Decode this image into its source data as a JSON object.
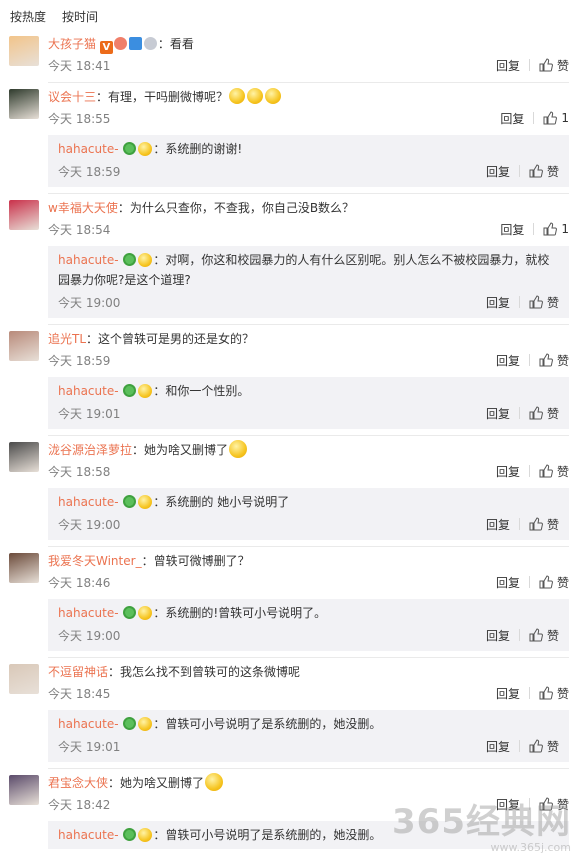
{
  "sort": {
    "hot": "按热度",
    "time": "按时间"
  },
  "actions": {
    "reply": "回复",
    "like": "赞"
  },
  "comments": [
    {
      "user": "大孩子猫",
      "text": "：看看",
      "time": "今天 18:41",
      "likes": "",
      "avatar_color": "#f2c48a",
      "badges": true,
      "replies": []
    },
    {
      "user": "议会十三",
      "text": "：有理，干吗删微博呢？",
      "time": "今天 18:55",
      "likes": "1",
      "avatar_color": "#2e3a2c",
      "emojis": 3,
      "replies": [
        {
          "user": "hahacute-",
          "text": "：系统删的谢谢!",
          "time": "今天 18:59"
        }
      ]
    },
    {
      "user": "w幸福大天使",
      "text": "：为什么只查你，不查我，你自己没B数么？",
      "time": "今天 18:54",
      "likes": "1",
      "avatar_color": "#c9304a",
      "replies": [
        {
          "user": "hahacute-",
          "text": "：对啊，你这和校园暴力的人有什么区别呢。别人怎么不被校园暴力，就校",
          "text2": "园暴力你呢?是这个道理?",
          "time": "今天 19:00"
        }
      ]
    },
    {
      "user": "追光TL",
      "text": "：这个曾轶可是男的还是女的？",
      "time": "今天 18:59",
      "likes": "",
      "avatar_color": "#b88a7a",
      "replies": [
        {
          "user": "hahacute-",
          "text": "：和你一个性别。",
          "time": "今天 19:01"
        }
      ]
    },
    {
      "user": "泷谷源治泽萝拉",
      "text": "：她为啥又删博了",
      "time": "今天 18:58",
      "likes": "",
      "avatar_color": "#4a4a4a",
      "emojis": 1,
      "replies": [
        {
          "user": "hahacute-",
          "text": "：系统删的 她小号说明了",
          "time": "今天 19:00"
        }
      ]
    },
    {
      "user": "我爱冬天Winter_",
      "text": "：曾轶可微博删了？",
      "time": "今天 18:46",
      "likes": "",
      "avatar_color": "#6b4a3a",
      "replies": [
        {
          "user": "hahacute-",
          "text": "：系统删的!曾轶可小号说明了。",
          "time": "今天 19:00"
        }
      ]
    },
    {
      "user": "不逗留神话",
      "text": "：我怎么找不到曾轶可的这条微博呢",
      "time": "今天 18:45",
      "likes": "",
      "avatar_color": "#d9c8b8",
      "replies": [
        {
          "user": "hahacute-",
          "text": "：曾轶可小号说明了是系统删的，她没删。",
          "time": "今天 19:01"
        }
      ]
    },
    {
      "user": "君宝念大侠",
      "text": "：她为啥又删博了",
      "time": "今天 18:42",
      "likes": "",
      "avatar_color": "#5a4a6a",
      "emojis": 1,
      "replies": [
        {
          "user": "hahacute-",
          "text": "：曾轶可小号说明了是系统删的，她没删。",
          "time": ""
        }
      ]
    }
  ],
  "watermark": {
    "big": "365经典网",
    "small": "www.365j.com"
  },
  "colors": {
    "username": "#eb7350",
    "reply_bg": "#f2f2f5",
    "text": "#333333",
    "meta": "#808080"
  }
}
